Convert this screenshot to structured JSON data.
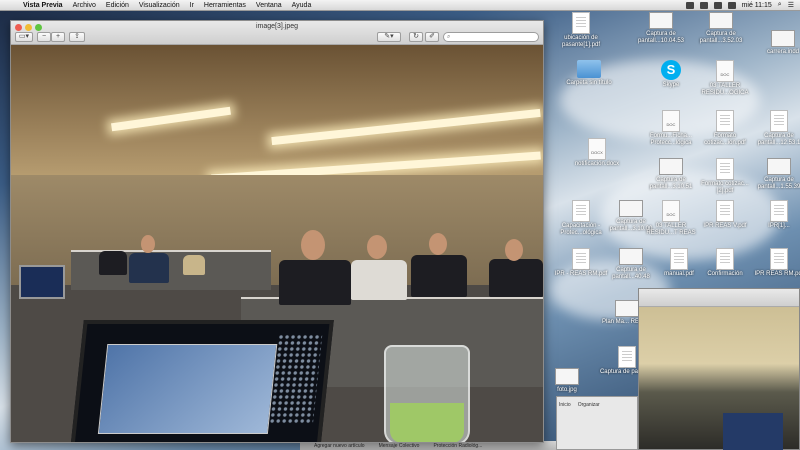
{
  "menubar": {
    "app_name": "Vista Previa",
    "items": [
      "Archivo",
      "Edición",
      "Visualización",
      "Ir",
      "Herramientas",
      "Ventana",
      "Ayuda"
    ],
    "clock": "mié 11:15"
  },
  "preview_window": {
    "title": "image[3].jpeg"
  },
  "desktop_icons": [
    {
      "label": "ubicación de pasante[1].pdf",
      "kind": "pdf"
    },
    {
      "label": "Captura de pantall...10.04.53",
      "kind": "thumb"
    },
    {
      "label": "Captura de pantall...3.52.03",
      "kind": "thumb"
    },
    {
      "label": "carrera.indd",
      "kind": "thumb"
    },
    {
      "label": "Carpeta sin título",
      "kind": "folder"
    },
    {
      "label": "Skype",
      "kind": "skype"
    },
    {
      "label": "03 TALLER RESIDU...OGICA",
      "kind": "doc",
      "tag": "DOC"
    },
    {
      "label": "Formu...Ficha... Protecc...lógica",
      "kind": "doc",
      "tag": "DOC"
    },
    {
      "label": "Formato cotizac...ión.pdf",
      "kind": "pdf"
    },
    {
      "label": "Captura de pantall...12.53.1",
      "kind": "pdf"
    },
    {
      "label": "notificación.docx",
      "kind": "doc",
      "tag": "DOCX"
    },
    {
      "label": "Captura de pantall...3.10.51",
      "kind": "thumb"
    },
    {
      "label": "Formato cotizac...[2].pdf",
      "kind": "pdf"
    },
    {
      "label": "Captura de pantall...1.55.39",
      "kind": "thumb"
    },
    {
      "label": "Capacitación - Protec...ológica",
      "kind": "pdf"
    },
    {
      "label": "Captura de pantall...3.10.00",
      "kind": "thumb"
    },
    {
      "label": "03 TALLER RESIDU...T REAS",
      "kind": "doc",
      "tag": "DOC"
    },
    {
      "label": "IPR REAS V.pdf",
      "kind": "pdf"
    },
    {
      "label": "IPR[1]...",
      "kind": "pdf"
    },
    {
      "label": "IPR - REAS RM.pdf",
      "kind": "pdf"
    },
    {
      "label": "Captura de pantall...40.48",
      "kind": "thumb"
    },
    {
      "label": "manual.pdf",
      "kind": "pdf"
    },
    {
      "label": "Confirmación",
      "kind": "pdf"
    },
    {
      "label": "IPR REAS RM.pdf",
      "kind": "pdf"
    },
    {
      "label": "Plan Ma... REAS...",
      "kind": "thumb"
    },
    {
      "label": "Captura de pantall...",
      "kind": "pdf"
    },
    {
      "label": "foto.jpg",
      "kind": "thumb"
    }
  ],
  "finder": {
    "segments": [
      "Inicio",
      "Organizar"
    ]
  },
  "taskbar": {
    "items": [
      "Agregar nuevo artículo",
      "Mensaje Colectivo",
      "Protección Radiológ..."
    ]
  },
  "colors": {
    "close": "#ee5d51",
    "minimize": "#f1bc35",
    "maximize": "#5fc540"
  }
}
